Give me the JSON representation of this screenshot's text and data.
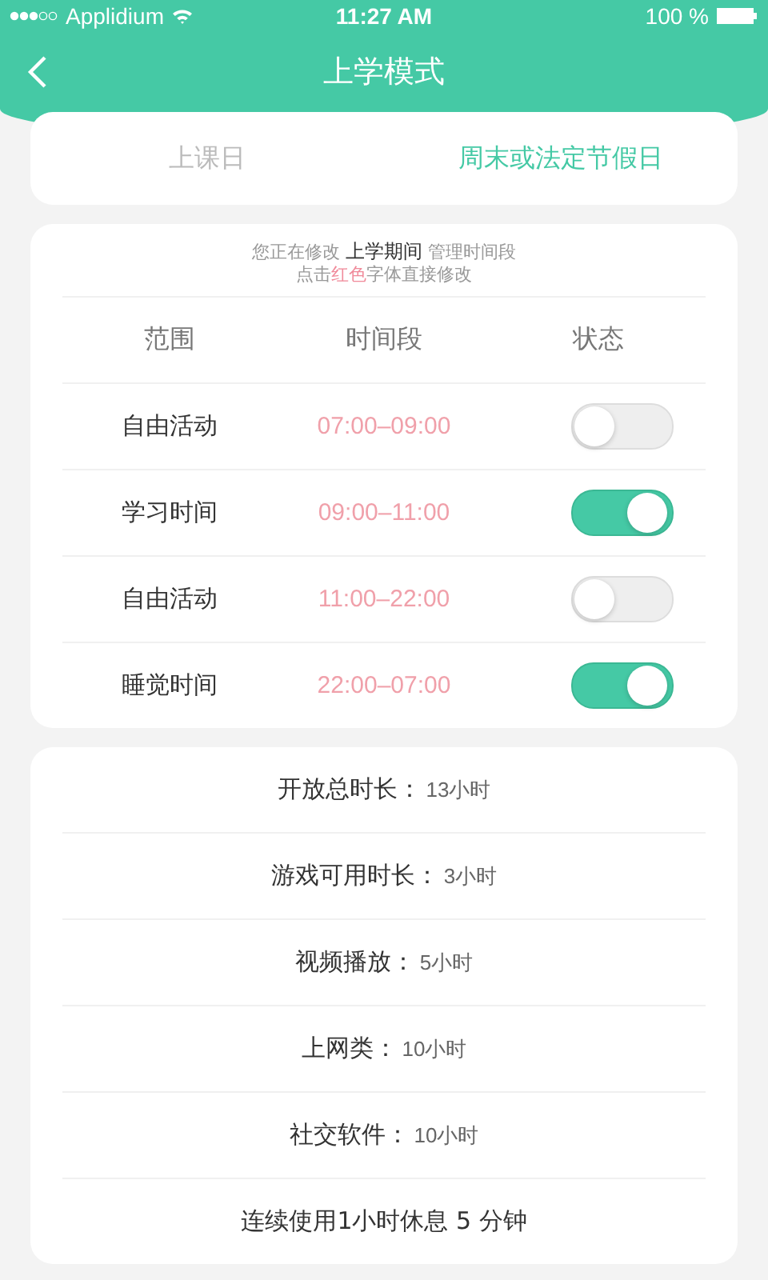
{
  "status_bar": {
    "carrier": "Applidium",
    "time": "11:27 AM",
    "battery": "100 %"
  },
  "nav": {
    "title": "上学模式"
  },
  "tabs": [
    {
      "label": "上课日",
      "selected": false
    },
    {
      "label": "周末或法定节假日",
      "selected": true
    }
  ],
  "notice": {
    "line1": "您正在修改 **上学期间** 管理时间段",
    "line2": [
      {
        "text": "点击",
        "kind": "plain"
      },
      {
        "text": "红色",
        "kind": "highlight"
      },
      {
        "text": "字体直接修改",
        "kind": "plain"
      }
    ]
  },
  "table": {
    "columns": [
      "范围",
      "时间段",
      "状态"
    ],
    "rows": [
      {
        "scope": "自由活动",
        "period": "07:00–09:00",
        "on": false
      },
      {
        "scope": "学习时间",
        "period": "09:00–11:00",
        "on": true
      },
      {
        "scope": "自由活动",
        "period": "11:00–22:00",
        "on": false
      },
      {
        "scope": "睡觉时间",
        "period": "22:00–07:00",
        "on": true
      }
    ]
  },
  "limits": [
    {
      "label": "开放总时长：",
      "value": "13小时"
    },
    {
      "label": "游戏可用时长：",
      "value": "3小时"
    },
    {
      "label": "视频播放：",
      "value": "5小时"
    },
    {
      "label": "上网类：",
      "value": "10小时"
    },
    {
      "label": "社交软件：",
      "value": "10小时"
    }
  ],
  "rest_rule": "连续使用1小时休息 5 分钟"
}
